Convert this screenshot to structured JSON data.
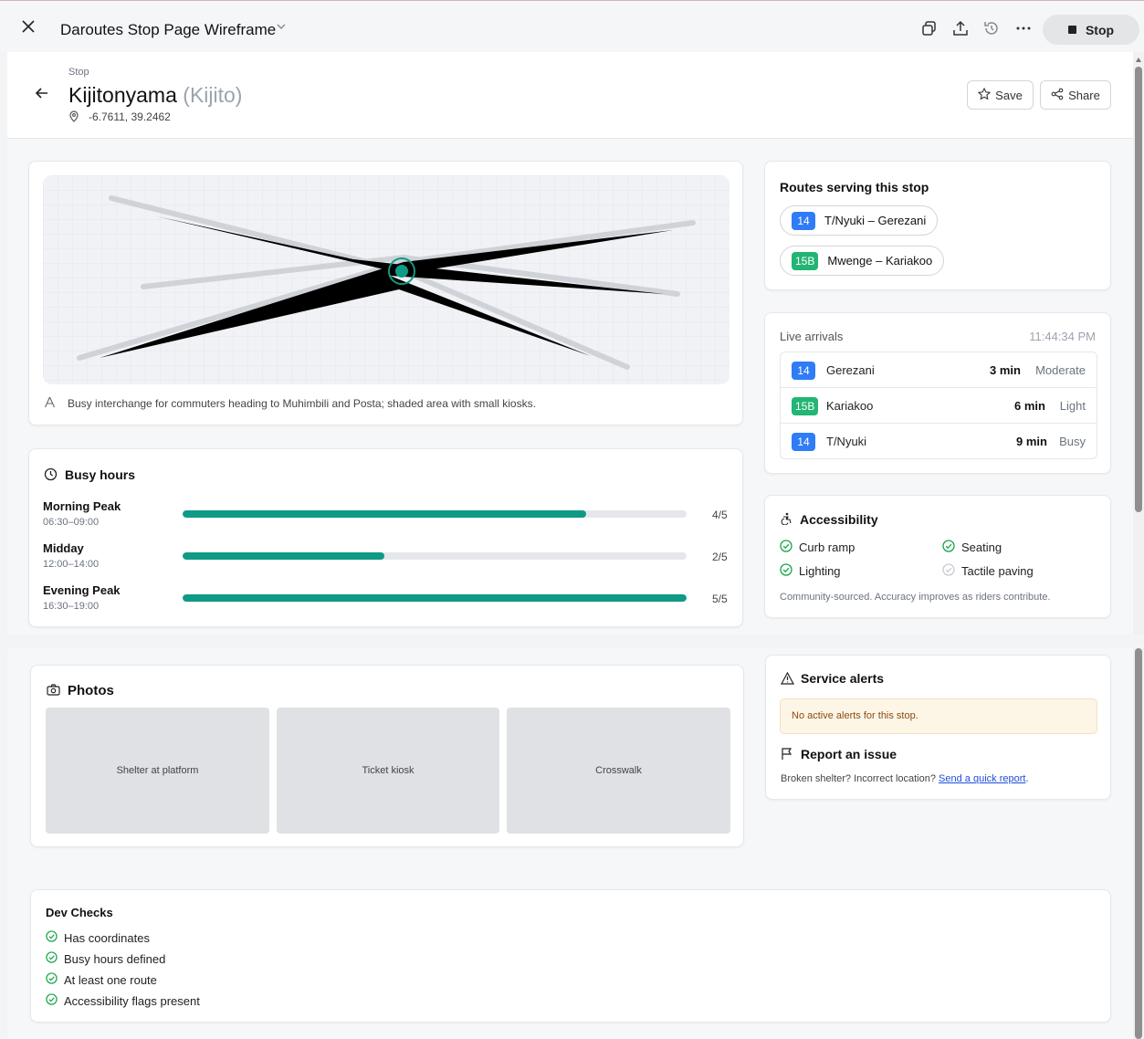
{
  "window": {
    "title": "Daroutes Stop Page Wireframe",
    "stop_label": "Stop"
  },
  "header": {
    "eyebrow": "Stop",
    "name": "Kijitonyama",
    "alias": "(Kijito)",
    "coords": "-6.7611, 39.2462",
    "save_label": "Save",
    "share_label": "Share"
  },
  "map": {
    "caption": "Busy interchange for commuters heading to Muhimbili and Posta; shaded area with small kiosks."
  },
  "busy_hours": {
    "title": "Busy hours",
    "rows": [
      {
        "label": "Morning Peak",
        "time": "06:30–09:00",
        "score": 4,
        "max": 5,
        "score_text": "4/5"
      },
      {
        "label": "Midday",
        "time": "12:00–14:00",
        "score": 2,
        "max": 5,
        "score_text": "2/5"
      },
      {
        "label": "Evening Peak",
        "time": "16:30–19:00",
        "score": 5,
        "max": 5,
        "score_text": "5/5"
      }
    ]
  },
  "routes": {
    "title": "Routes serving this stop",
    "items": [
      {
        "code": "14",
        "name": "T/Nyuki – Gerezani",
        "color": "#2f7cf6"
      },
      {
        "code": "15B",
        "name": "Mwenge – Kariakoo",
        "color": "#22b573"
      }
    ]
  },
  "arrivals": {
    "title": "Live arrivals",
    "time": "11:44:34 PM",
    "items": [
      {
        "code": "14",
        "dest": "Gerezani",
        "eta": "3 min",
        "crowd": "Moderate",
        "color": "#2f7cf6"
      },
      {
        "code": "15B",
        "dest": "Kariakoo",
        "eta": "6 min",
        "crowd": "Light",
        "color": "#22b573"
      },
      {
        "code": "14",
        "dest": "T/Nyuki",
        "eta": "9 min",
        "crowd": "Busy",
        "color": "#2f7cf6"
      }
    ]
  },
  "accessibility": {
    "title": "Accessibility",
    "items": [
      {
        "label": "Curb ramp",
        "available": true
      },
      {
        "label": "Seating",
        "available": true
      },
      {
        "label": "Lighting",
        "available": true
      },
      {
        "label": "Tactile paving",
        "available": false
      }
    ],
    "note": "Community-sourced. Accuracy improves as riders contribute."
  },
  "photos": {
    "title": "Photos",
    "items": [
      "Shelter at platform",
      "Ticket kiosk",
      "Crosswalk"
    ]
  },
  "alerts": {
    "title": "Service alerts",
    "message": "No active alerts for this stop.",
    "report_title": "Report an issue",
    "report_text": "Broken shelter? Incorrect location?",
    "report_link": "Send a quick report",
    "report_end": "."
  },
  "dev_checks": {
    "title": "Dev Checks",
    "items": [
      "Has coordinates",
      "Busy hours defined",
      "At least one route",
      "Accessibility flags present"
    ]
  },
  "colors": {
    "accent": "#0f9a86",
    "route_blue": "#2f7cf6",
    "route_green": "#22b573",
    "check_green": "#16a34a"
  }
}
